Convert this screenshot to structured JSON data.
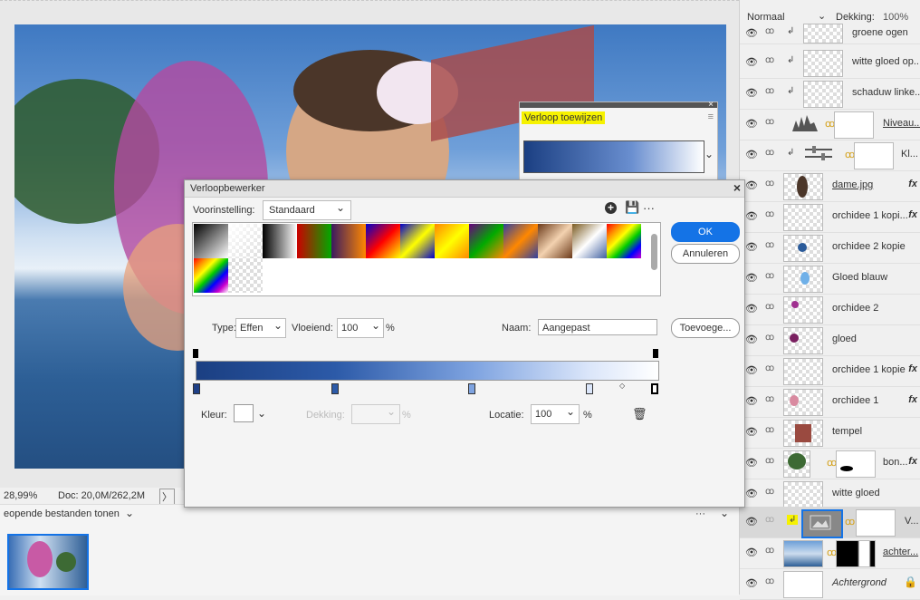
{
  "status": {
    "zoom": "28,99%",
    "doc": "Doc: 20,0M/262,2M",
    "arrow": "〉"
  },
  "files_bar": {
    "label": "eopende bestanden tonen",
    "dropdown": "⌄",
    "more": "···"
  },
  "layers_header": {
    "blend_mode": "Normaal",
    "opacity_label": "Dekking:",
    "opacity_value": "100%"
  },
  "layers": [
    {
      "name": "groene ogen"
    },
    {
      "name": "witte gloed op..."
    },
    {
      "name": "schaduw linke..."
    },
    {
      "name": "Niveau..."
    },
    {
      "name": "Kl..."
    },
    {
      "name": "dame.jpg",
      "fx": "fx"
    },
    {
      "name": "orchidee 1 kopi...",
      "fx": "fx"
    },
    {
      "name": "orchidee 2 kopie"
    },
    {
      "name": "Gloed blauw"
    },
    {
      "name": "orchidee 2"
    },
    {
      "name": "gloed"
    },
    {
      "name": "orchidee 1 kopie",
      "fx": "fx"
    },
    {
      "name": "orchidee 1",
      "fx": "fx"
    },
    {
      "name": "tempel"
    },
    {
      "name": "bon...",
      "fx": "fx"
    },
    {
      "name": "witte gloed"
    },
    {
      "name": "V..."
    },
    {
      "name": "achter..."
    },
    {
      "name": "Achtergrond"
    }
  ],
  "gradient_popup": {
    "title": "Verloop toewijzen",
    "menu": "≡"
  },
  "dialog": {
    "title": "Verloopbewerker",
    "preset_label": "Voorinstelling:",
    "preset_value": "Standaard",
    "ok": "OK",
    "cancel": "Annuleren",
    "add": "Toevoege...",
    "type_label": "Type:",
    "type_value": "Effen",
    "smooth_label": "Vloeiend:",
    "smooth_value": "100",
    "smooth_unit": "%",
    "name_label": "Naam:",
    "name_value": "Aangepast",
    "color_label": "Kleur:",
    "opacity_label": "Dekking:",
    "opacity_unit": "%",
    "location_label": "Locatie:",
    "location_value": "100",
    "location_unit": "%"
  },
  "colors": {
    "gradient_start": "#1b3f82",
    "gradient_end": "#ffffff",
    "accent": "#1473e6",
    "highlight": "#f6f200"
  }
}
